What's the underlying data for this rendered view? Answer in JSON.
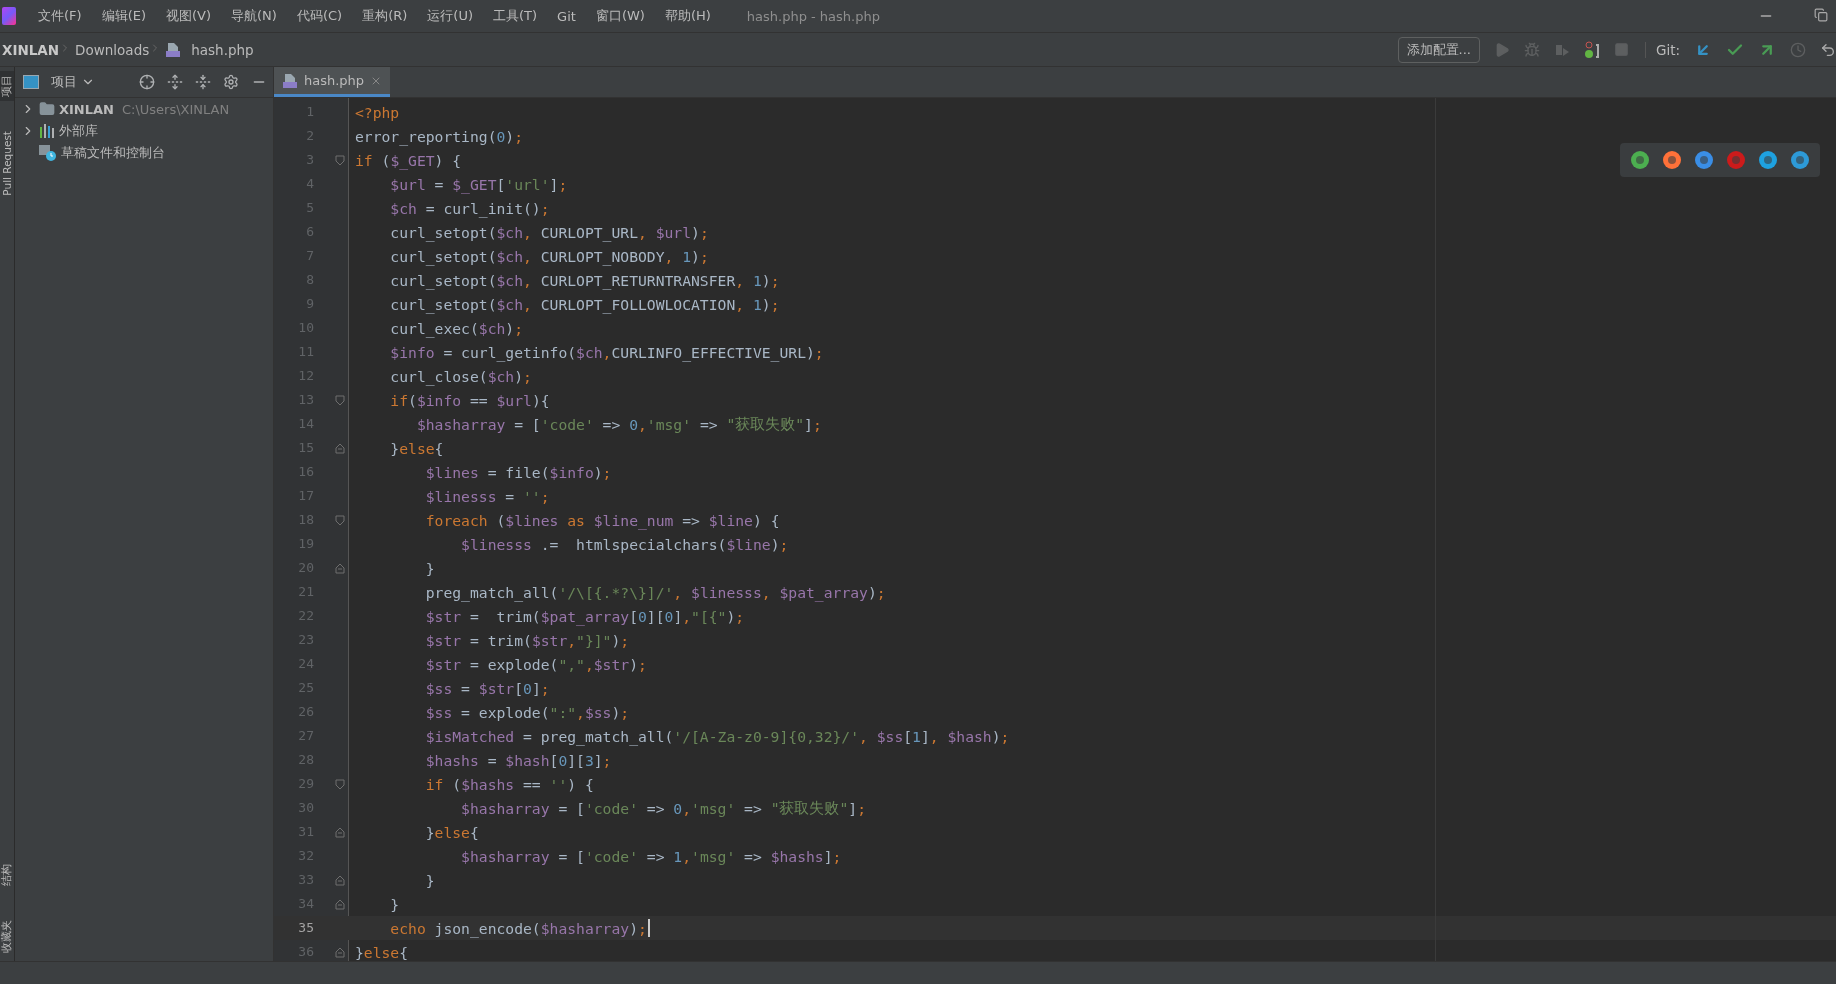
{
  "menu_bar": {
    "items": [
      "文件(F)",
      "编辑(E)",
      "视图(V)",
      "导航(N)",
      "代码(C)",
      "重构(R)",
      "运行(U)",
      "工具(T)",
      "Git",
      "窗口(W)",
      "帮助(H)"
    ],
    "title": "hash.php - hash.php"
  },
  "breadcrumbs": [
    "XINLAN",
    "Downloads",
    "hash.php"
  ],
  "toolbar": {
    "run_config": "添加配置...",
    "git_label": "Git:"
  },
  "left_strip": {
    "top": [
      {
        "label": "项目",
        "selected": true
      },
      {
        "label": "Pull Request",
        "selected": false
      }
    ],
    "bottom": [
      {
        "label": "结构",
        "selected": false
      },
      {
        "label": "收藏夹",
        "selected": false
      }
    ]
  },
  "project_panel": {
    "title": "项目",
    "tree": [
      {
        "name": "XINLAN",
        "path": "C:\\Users\\XINLAN",
        "kind": "folder",
        "expanded": false
      },
      {
        "name": "外部库",
        "kind": "library",
        "expanded": false
      },
      {
        "name": "草稿文件和控制台",
        "kind": "scratch"
      }
    ]
  },
  "editor": {
    "tabs": [
      {
        "label": "hash.php",
        "selected": true
      }
    ],
    "lines": [
      {
        "n": "1",
        "current": false,
        "kind": "plain",
        "tokens": [
          {
            "kind": "keyword",
            "text": "<?php"
          }
        ]
      },
      {
        "n": "2",
        "current": false,
        "kind": "plain",
        "tokens": [
          {
            "kind": "plain",
            "text": "error_reporting("
          },
          {
            "kind": "number",
            "text": "0"
          },
          {
            "kind": "plain",
            "text": ")"
          },
          {
            "kind": "punct",
            "text": ";"
          }
        ]
      },
      {
        "n": "3",
        "current": false,
        "kind": "fold_start",
        "tokens": [
          {
            "kind": "keyword",
            "text": "if "
          },
          {
            "kind": "plain",
            "text": "("
          },
          {
            "kind": "variable",
            "text": "$_GET"
          },
          {
            "kind": "plain",
            "text": ") {"
          }
        ]
      },
      {
        "n": "4",
        "current": false,
        "kind": "plain",
        "tokens": [
          {
            "kind": "variable",
            "text": "    $url"
          },
          {
            "kind": "plain",
            "text": " = "
          },
          {
            "kind": "variable",
            "text": "$_GET"
          },
          {
            "kind": "plain",
            "text": "["
          },
          {
            "kind": "string",
            "text": "'url'"
          },
          {
            "kind": "plain",
            "text": "]"
          },
          {
            "kind": "punct",
            "text": ";"
          }
        ]
      },
      {
        "n": "5",
        "current": false,
        "kind": "plain",
        "tokens": [
          {
            "kind": "variable",
            "text": "    $ch"
          },
          {
            "kind": "plain",
            "text": " = curl_init()"
          },
          {
            "kind": "punct",
            "text": ";"
          }
        ]
      },
      {
        "n": "6",
        "current": false,
        "kind": "plain",
        "tokens": [
          {
            "kind": "plain",
            "text": "    curl_setopt("
          },
          {
            "kind": "variable",
            "text": "$ch"
          },
          {
            "kind": "punct",
            "text": ", "
          },
          {
            "kind": "plain",
            "text": "CURLOPT_URL"
          },
          {
            "kind": "punct",
            "text": ", "
          },
          {
            "kind": "variable",
            "text": "$url"
          },
          {
            "kind": "plain",
            "text": ")"
          },
          {
            "kind": "punct",
            "text": ";"
          }
        ]
      },
      {
        "n": "7",
        "current": false,
        "kind": "plain",
        "tokens": [
          {
            "kind": "plain",
            "text": "    curl_setopt("
          },
          {
            "kind": "variable",
            "text": "$ch"
          },
          {
            "kind": "punct",
            "text": ", "
          },
          {
            "kind": "plain",
            "text": "CURLOPT_NOBODY"
          },
          {
            "kind": "punct",
            "text": ", "
          },
          {
            "kind": "number",
            "text": "1"
          },
          {
            "kind": "plain",
            "text": ")"
          },
          {
            "kind": "punct",
            "text": ";"
          }
        ]
      },
      {
        "n": "8",
        "current": false,
        "kind": "plain",
        "tokens": [
          {
            "kind": "plain",
            "text": "    curl_setopt("
          },
          {
            "kind": "variable",
            "text": "$ch"
          },
          {
            "kind": "punct",
            "text": ", "
          },
          {
            "kind": "plain",
            "text": "CURLOPT_RETURNTRANSFER"
          },
          {
            "kind": "punct",
            "text": ", "
          },
          {
            "kind": "number",
            "text": "1"
          },
          {
            "kind": "plain",
            "text": ")"
          },
          {
            "kind": "punct",
            "text": ";"
          }
        ]
      },
      {
        "n": "9",
        "current": false,
        "kind": "plain",
        "tokens": [
          {
            "kind": "plain",
            "text": "    curl_setopt("
          },
          {
            "kind": "variable",
            "text": "$ch"
          },
          {
            "kind": "punct",
            "text": ", "
          },
          {
            "kind": "plain",
            "text": "CURLOPT_FOLLOWLOCATION"
          },
          {
            "kind": "punct",
            "text": ", "
          },
          {
            "kind": "number",
            "text": "1"
          },
          {
            "kind": "plain",
            "text": ")"
          },
          {
            "kind": "punct",
            "text": ";"
          }
        ]
      },
      {
        "n": "10",
        "current": false,
        "kind": "plain",
        "tokens": [
          {
            "kind": "plain",
            "text": "    curl_exec("
          },
          {
            "kind": "variable",
            "text": "$ch"
          },
          {
            "kind": "plain",
            "text": ")"
          },
          {
            "kind": "punct",
            "text": ";"
          }
        ]
      },
      {
        "n": "11",
        "current": false,
        "kind": "plain",
        "tokens": [
          {
            "kind": "variable",
            "text": "    $info"
          },
          {
            "kind": "plain",
            "text": " = curl_getinfo("
          },
          {
            "kind": "variable",
            "text": "$ch"
          },
          {
            "kind": "punct",
            "text": ","
          },
          {
            "kind": "plain",
            "text": "CURLINFO_EFFECTIVE_URL)"
          },
          {
            "kind": "punct",
            "text": ";"
          }
        ]
      },
      {
        "n": "12",
        "current": false,
        "kind": "plain",
        "tokens": [
          {
            "kind": "plain",
            "text": "    curl_close("
          },
          {
            "kind": "variable",
            "text": "$ch"
          },
          {
            "kind": "plain",
            "text": ")"
          },
          {
            "kind": "punct",
            "text": ";"
          }
        ]
      },
      {
        "n": "13",
        "current": false,
        "kind": "fold_start",
        "tokens": [
          {
            "kind": "keyword",
            "text": "    if"
          },
          {
            "kind": "plain",
            "text": "("
          },
          {
            "kind": "variable",
            "text": "$info"
          },
          {
            "kind": "plain",
            "text": " == "
          },
          {
            "kind": "variable",
            "text": "$url"
          },
          {
            "kind": "plain",
            "text": "){"
          }
        ]
      },
      {
        "n": "14",
        "current": false,
        "kind": "plain",
        "tokens": [
          {
            "kind": "variable",
            "text": "       $hasharray"
          },
          {
            "kind": "plain",
            "text": " = ["
          },
          {
            "kind": "string",
            "text": "'code'"
          },
          {
            "kind": "plain",
            "text": " => "
          },
          {
            "kind": "number",
            "text": "0"
          },
          {
            "kind": "punct",
            "text": ","
          },
          {
            "kind": "string",
            "text": "'msg'"
          },
          {
            "kind": "plain",
            "text": " => "
          },
          {
            "kind": "string",
            "text": "\"获取失败\""
          },
          {
            "kind": "plain",
            "text": "]"
          },
          {
            "kind": "punct",
            "text": ";"
          }
        ]
      },
      {
        "n": "15",
        "current": false,
        "kind": "fold_end",
        "tokens": [
          {
            "kind": "plain",
            "text": "    }"
          },
          {
            "kind": "keyword",
            "text": "else"
          },
          {
            "kind": "plain",
            "text": "{"
          }
        ]
      },
      {
        "n": "16",
        "current": false,
        "kind": "plain",
        "tokens": [
          {
            "kind": "variable",
            "text": "        $lines"
          },
          {
            "kind": "plain",
            "text": " = file("
          },
          {
            "kind": "variable",
            "text": "$info"
          },
          {
            "kind": "plain",
            "text": ")"
          },
          {
            "kind": "punct",
            "text": ";"
          }
        ]
      },
      {
        "n": "17",
        "current": false,
        "kind": "plain",
        "tokens": [
          {
            "kind": "variable",
            "text": "        $linesss"
          },
          {
            "kind": "plain",
            "text": " = "
          },
          {
            "kind": "string",
            "text": "''"
          },
          {
            "kind": "punct",
            "text": ";"
          }
        ]
      },
      {
        "n": "18",
        "current": false,
        "kind": "fold_start",
        "tokens": [
          {
            "kind": "keyword",
            "text": "        foreach "
          },
          {
            "kind": "plain",
            "text": "("
          },
          {
            "kind": "variable",
            "text": "$lines"
          },
          {
            "kind": "keyword",
            "text": " as "
          },
          {
            "kind": "variable",
            "text": "$line_num"
          },
          {
            "kind": "plain",
            "text": " => "
          },
          {
            "kind": "variable",
            "text": "$line"
          },
          {
            "kind": "plain",
            "text": ") {"
          }
        ]
      },
      {
        "n": "19",
        "current": false,
        "kind": "plain",
        "tokens": [
          {
            "kind": "variable",
            "text": "            $linesss"
          },
          {
            "kind": "plain",
            "text": " .=  htmlspecialchars("
          },
          {
            "kind": "variable",
            "text": "$line"
          },
          {
            "kind": "plain",
            "text": ")"
          },
          {
            "kind": "punct",
            "text": ";"
          }
        ]
      },
      {
        "n": "20",
        "current": false,
        "kind": "fold_end",
        "tokens": [
          {
            "kind": "plain",
            "text": "        }"
          }
        ]
      },
      {
        "n": "21",
        "current": false,
        "kind": "plain",
        "tokens": [
          {
            "kind": "plain",
            "text": "        preg_match_all("
          },
          {
            "kind": "string",
            "text": "'/\\[{.*?\\}]/'"
          },
          {
            "kind": "punct",
            "text": ", "
          },
          {
            "kind": "variable",
            "text": "$linesss"
          },
          {
            "kind": "punct",
            "text": ", "
          },
          {
            "kind": "variable",
            "text": "$pat_array"
          },
          {
            "kind": "plain",
            "text": ")"
          },
          {
            "kind": "punct",
            "text": ";"
          }
        ]
      },
      {
        "n": "22",
        "current": false,
        "kind": "plain",
        "tokens": [
          {
            "kind": "variable",
            "text": "        $str"
          },
          {
            "kind": "plain",
            "text": " =  trim("
          },
          {
            "kind": "variable",
            "text": "$pat_array"
          },
          {
            "kind": "plain",
            "text": "["
          },
          {
            "kind": "number",
            "text": "0"
          },
          {
            "kind": "plain",
            "text": "]["
          },
          {
            "kind": "number",
            "text": "0"
          },
          {
            "kind": "plain",
            "text": "]"
          },
          {
            "kind": "punct",
            "text": ","
          },
          {
            "kind": "string",
            "text": "\"[{\""
          },
          {
            "kind": "plain",
            "text": ")"
          },
          {
            "kind": "punct",
            "text": ";"
          }
        ]
      },
      {
        "n": "23",
        "current": false,
        "kind": "plain",
        "tokens": [
          {
            "kind": "variable",
            "text": "        $str"
          },
          {
            "kind": "plain",
            "text": " = trim("
          },
          {
            "kind": "variable",
            "text": "$str"
          },
          {
            "kind": "punct",
            "text": ","
          },
          {
            "kind": "string",
            "text": "\"}]\""
          },
          {
            "kind": "plain",
            "text": ")"
          },
          {
            "kind": "punct",
            "text": ";"
          }
        ]
      },
      {
        "n": "24",
        "current": false,
        "kind": "plain",
        "tokens": [
          {
            "kind": "variable",
            "text": "        $str"
          },
          {
            "kind": "plain",
            "text": " = explode("
          },
          {
            "kind": "string",
            "text": "\",\""
          },
          {
            "kind": "punct",
            "text": ","
          },
          {
            "kind": "variable",
            "text": "$str"
          },
          {
            "kind": "plain",
            "text": ")"
          },
          {
            "kind": "punct",
            "text": ";"
          }
        ]
      },
      {
        "n": "25",
        "current": false,
        "kind": "plain",
        "tokens": [
          {
            "kind": "variable",
            "text": "        $ss"
          },
          {
            "kind": "plain",
            "text": " = "
          },
          {
            "kind": "variable",
            "text": "$str"
          },
          {
            "kind": "plain",
            "text": "["
          },
          {
            "kind": "number",
            "text": "0"
          },
          {
            "kind": "plain",
            "text": "]"
          },
          {
            "kind": "punct",
            "text": ";"
          }
        ]
      },
      {
        "n": "26",
        "current": false,
        "kind": "plain",
        "tokens": [
          {
            "kind": "variable",
            "text": "        $ss"
          },
          {
            "kind": "plain",
            "text": " = explode("
          },
          {
            "kind": "string",
            "text": "\":\""
          },
          {
            "kind": "punct",
            "text": ","
          },
          {
            "kind": "variable",
            "text": "$ss"
          },
          {
            "kind": "plain",
            "text": ")"
          },
          {
            "kind": "punct",
            "text": ";"
          }
        ]
      },
      {
        "n": "27",
        "current": false,
        "kind": "plain",
        "tokens": [
          {
            "kind": "variable",
            "text": "        $isMatched"
          },
          {
            "kind": "plain",
            "text": " = preg_match_all("
          },
          {
            "kind": "string",
            "text": "'/[A-Za-z0-9]{0,32}/'"
          },
          {
            "kind": "punct",
            "text": ", "
          },
          {
            "kind": "variable",
            "text": "$ss"
          },
          {
            "kind": "plain",
            "text": "["
          },
          {
            "kind": "number",
            "text": "1"
          },
          {
            "kind": "plain",
            "text": "]"
          },
          {
            "kind": "punct",
            "text": ", "
          },
          {
            "kind": "variable",
            "text": "$hash"
          },
          {
            "kind": "plain",
            "text": ")"
          },
          {
            "kind": "punct",
            "text": ";"
          }
        ]
      },
      {
        "n": "28",
        "current": false,
        "kind": "plain",
        "tokens": [
          {
            "kind": "variable",
            "text": "        $hashs"
          },
          {
            "kind": "plain",
            "text": " = "
          },
          {
            "kind": "variable",
            "text": "$hash"
          },
          {
            "kind": "plain",
            "text": "["
          },
          {
            "kind": "number",
            "text": "0"
          },
          {
            "kind": "plain",
            "text": "]["
          },
          {
            "kind": "number",
            "text": "3"
          },
          {
            "kind": "plain",
            "text": "]"
          },
          {
            "kind": "punct",
            "text": ";"
          }
        ]
      },
      {
        "n": "29",
        "current": false,
        "kind": "fold_start",
        "tokens": [
          {
            "kind": "keyword",
            "text": "        if "
          },
          {
            "kind": "plain",
            "text": "("
          },
          {
            "kind": "variable",
            "text": "$hashs"
          },
          {
            "kind": "plain",
            "text": " == "
          },
          {
            "kind": "string",
            "text": "''"
          },
          {
            "kind": "plain",
            "text": ") {"
          }
        ]
      },
      {
        "n": "30",
        "current": false,
        "kind": "plain",
        "tokens": [
          {
            "kind": "variable",
            "text": "            $hasharray"
          },
          {
            "kind": "plain",
            "text": " = ["
          },
          {
            "kind": "string",
            "text": "'code'"
          },
          {
            "kind": "plain",
            "text": " => "
          },
          {
            "kind": "number",
            "text": "0"
          },
          {
            "kind": "punct",
            "text": ","
          },
          {
            "kind": "string",
            "text": "'msg'"
          },
          {
            "kind": "plain",
            "text": " => "
          },
          {
            "kind": "string",
            "text": "\"获取失败\""
          },
          {
            "kind": "plain",
            "text": "]"
          },
          {
            "kind": "punct",
            "text": ";"
          }
        ]
      },
      {
        "n": "31",
        "current": false,
        "kind": "fold_end",
        "tokens": [
          {
            "kind": "plain",
            "text": "        }"
          },
          {
            "kind": "keyword",
            "text": "else"
          },
          {
            "kind": "plain",
            "text": "{"
          }
        ]
      },
      {
        "n": "32",
        "current": false,
        "kind": "plain",
        "tokens": [
          {
            "kind": "variable",
            "text": "            $hasharray"
          },
          {
            "kind": "plain",
            "text": " = ["
          },
          {
            "kind": "string",
            "text": "'code'"
          },
          {
            "kind": "plain",
            "text": " => "
          },
          {
            "kind": "number",
            "text": "1"
          },
          {
            "kind": "punct",
            "text": ","
          },
          {
            "kind": "string",
            "text": "'msg'"
          },
          {
            "kind": "plain",
            "text": " => "
          },
          {
            "kind": "variable",
            "text": "$hashs"
          },
          {
            "kind": "plain",
            "text": "]"
          },
          {
            "kind": "punct",
            "text": ";"
          }
        ]
      },
      {
        "n": "33",
        "current": false,
        "kind": "fold_end",
        "tokens": [
          {
            "kind": "plain",
            "text": "        }"
          }
        ]
      },
      {
        "n": "34",
        "current": false,
        "kind": "fold_end",
        "tokens": [
          {
            "kind": "plain",
            "text": "    }"
          }
        ]
      },
      {
        "n": "35",
        "current": true,
        "kind": "plain",
        "tokens": [
          {
            "kind": "keyword",
            "text": "    echo "
          },
          {
            "kind": "plain",
            "text": "json_encode("
          },
          {
            "kind": "variable",
            "text": "$hasharray"
          },
          {
            "kind": "plain",
            "text": ")"
          },
          {
            "kind": "punct",
            "text": ";"
          }
        ]
      },
      {
        "n": "36",
        "current": false,
        "kind": "fold_end",
        "tokens": [
          {
            "kind": "plain",
            "text": "}"
          },
          {
            "kind": "keyword",
            "text": "else"
          },
          {
            "kind": "plain",
            "text": "{"
          }
        ]
      }
    ]
  }
}
